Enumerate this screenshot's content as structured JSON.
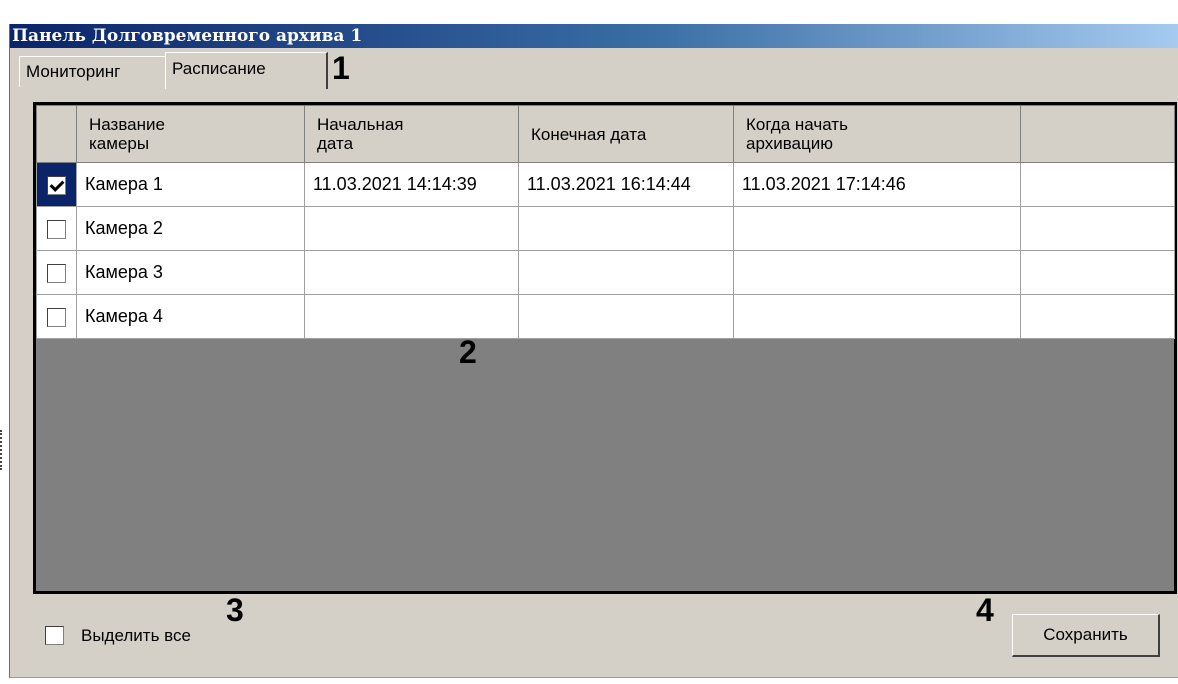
{
  "window": {
    "title": "Панель Долговременного архива 1"
  },
  "tabs": [
    {
      "label": "Мониторинг",
      "active": false
    },
    {
      "label": "Расписание",
      "active": true
    }
  ],
  "markers": [
    "1",
    "2",
    "3",
    "4"
  ],
  "table": {
    "headers": [
      "Название\nкамеры",
      "Начальная\nдата",
      "Конечная дата",
      "Когда начать\nархивацию"
    ],
    "rows": [
      {
        "checked": true,
        "name": "Камера 1",
        "start": "11.03.2021 14:14:39",
        "end": "11.03.2021 16:14:44",
        "archive_at": "11.03.2021 17:14:46"
      },
      {
        "checked": false,
        "name": "Камера 2",
        "start": "",
        "end": "",
        "archive_at": ""
      },
      {
        "checked": false,
        "name": "Камера 3",
        "start": "",
        "end": "",
        "archive_at": ""
      },
      {
        "checked": false,
        "name": "Камера 4",
        "start": "",
        "end": "",
        "archive_at": ""
      }
    ]
  },
  "footer": {
    "select_all_label": "Выделить все",
    "select_all_checked": false,
    "save_label": "Сохранить"
  }
}
